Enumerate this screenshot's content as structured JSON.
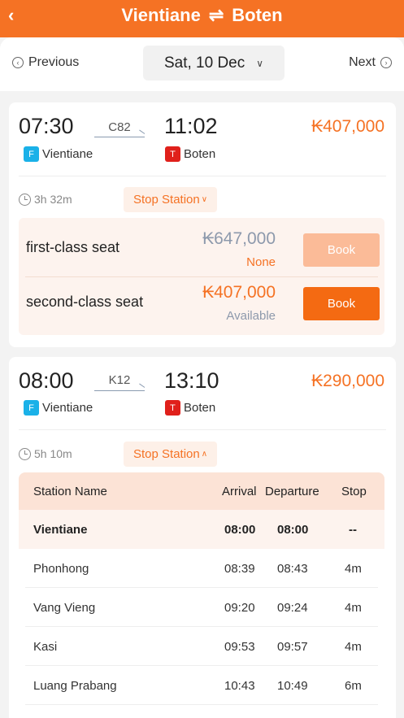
{
  "header": {
    "back_icon": "chevron-left-icon",
    "from": "Vientiane",
    "swap_symbol": "⇌",
    "to": "Boten",
    "color": "#f57224"
  },
  "datebar": {
    "previous_label": "Previous",
    "date": "Sat, 10 Dec",
    "next_label": "Next"
  },
  "trains": [
    {
      "depart_time": "07:30",
      "train_no": "C82",
      "arrive_time": "11:02",
      "from_badge": "F",
      "from_station": "Vientiane",
      "to_badge": "T",
      "to_station": "Boten",
      "price": "₭407,000",
      "duration": "3h 32m",
      "stop_label": "Stop Station",
      "seats": [
        {
          "name": "first-class seat",
          "price": "₭647,000",
          "status": "None",
          "book_label": "Book",
          "enabled": false
        },
        {
          "name": "second-class seat",
          "price": "₭407,000",
          "status": "Available",
          "book_label": "Book",
          "enabled": true
        }
      ]
    },
    {
      "depart_time": "08:00",
      "train_no": "K12",
      "arrive_time": "13:10",
      "from_badge": "F",
      "from_station": "Vientiane",
      "to_badge": "T",
      "to_station": "Boten",
      "price": "₭290,000",
      "duration": "5h 10m",
      "stop_label": "Stop Station",
      "stops_table": {
        "headers": [
          "Station Name",
          "Arrival",
          "Departure",
          "Stop"
        ],
        "rows": [
          [
            "Vientiane",
            "08:00",
            "08:00",
            "--"
          ],
          [
            "Phonhong",
            "08:39",
            "08:43",
            "4m"
          ],
          [
            "Vang Vieng",
            "09:20",
            "09:24",
            "4m"
          ],
          [
            "Kasi",
            "09:53",
            "09:57",
            "4m"
          ],
          [
            "Luang Prabang",
            "10:43",
            "10:49",
            "6m"
          ]
        ]
      }
    }
  ]
}
